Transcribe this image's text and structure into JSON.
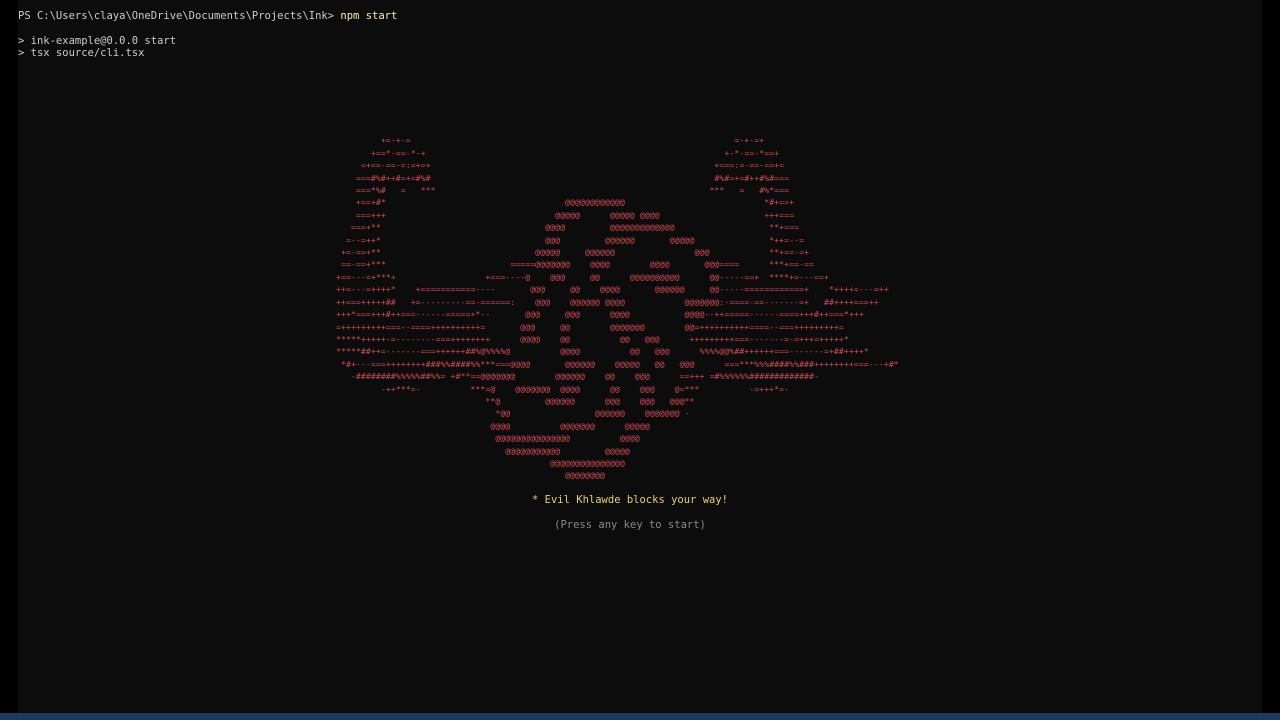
{
  "terminal": {
    "prompt": "PS C:\\Users\\claya\\OneDrive\\Documents\\Projects\\Ink>",
    "command": "npm start",
    "script_lines": [
      "> ink-example@0.0.0 start",
      "> tsx source/cli.tsx"
    ],
    "art_color": "#d24a55",
    "ascii_art": "                                                                                               \n         +=-+-=                                                                 =-+-=+           \n       +==*-==-*-+                                                            +-*-==-*==+        \n     =+==-==-=:=+=+                                                         +===:=-==-==+=       \n    ===#%#++#=+=#%#                                                         #%#=+=#++#%#===      \n    ===*%#   =   ***                                                       ***   =   #%*===      \n    +==+#*                                    @@@@@@@@@@@@                            *#+==+     \n    ===+++                                  @@@@@      @@@@@ @@@@                     +++===     \n   ===+**                                 @@@@         @@@@@@@@@@@@@                   **+===    \n  =--=++*                                 @@@         @@@@@@       @@@@@               *++=--=   \n +=-==+**                               @@@@@     @@@@@@                @@@            **+==-=+  \n ==-==+***                         =====@@@@@@@    @@@@        @@@@       @@@====      ***+==-== \n+==---=+***+                  +===----@    @@@     @@      @@@@@@@@@@      @@-----==+  ****+=---==+\n++=---=++++*    +===========----       @@@     @@    @@@@       @@@@@@     @@-----============+    *++++=---=++\n++===+++++##   +=---------==-======:    @@@    @@@@@@ @@@@            @@@@@@@:-====-==-------=+   ##++++===++\n+++*===+++#++===------=====+*--       @@@     @@@      @@@@           @@@@--++=====------====+++#++===*+++\n=+++++++++===--====++++++++++=       @@@     @@        @@@@@@@        @@=++++++++++====--===+++++++++=\n*****+++++-=--------===++++++++      @@@@    @@          @@   @@@      +++++++++===-------=-=+++=+++++*\n*****##++=-------===++++++##%@%%%%@          @@@@          @@   @@@      %%%%@@%##++++++===-------=+##++++*\n *#+---===++++++++###%%####%%***===@@@@       @@@@@@    @@@@@   @@   @@@      ===***%%%####%%###++++++++===---+#*\n   -########%%%%%##%%= +#**==@@@@@@@        @@@@@@    @@    @@@      ==+++ =#%%%%%%#############-\n         -++***=-          ***=@    @@@@@@@  @@@@      @@    @@@    @=***          -=+++*=-\n                              **@         @@@@@@      @@@    @@@   @@@**\n                                *@@                 @@@@@@    @@@@@@@ -\n                               @@@@          @@@@@@@      @@@@@\n                                @@@@@@@@@@@@@@@          @@@@\n                                  @@@@@@@@@@@         @@@@@\n                                           @@@@@@@@@@@@@@@\n                                              @@@@@@@@",
    "title": "* Evil Khlawde blocks your way!",
    "hint": "(Press any key to start)"
  }
}
